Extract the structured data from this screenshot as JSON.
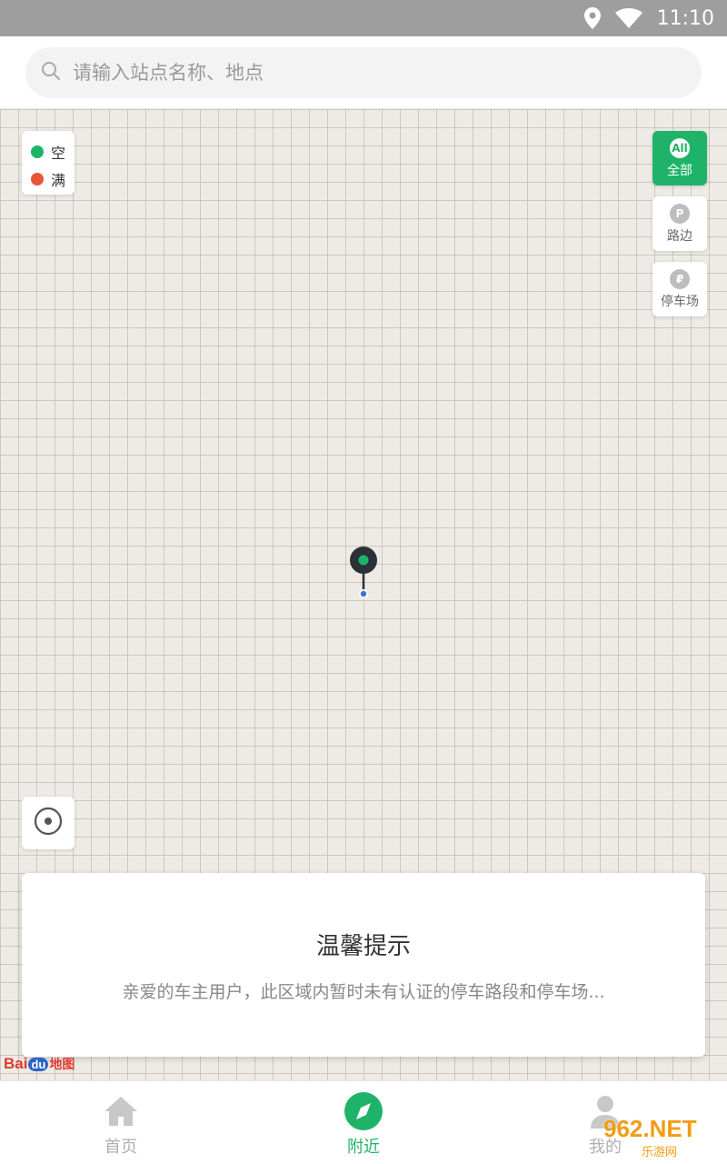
{
  "status_bar": {
    "time": "11:10"
  },
  "search": {
    "placeholder": "请输入站点名称、地点"
  },
  "legend": [
    {
      "label": "空",
      "color": "#1fb36a"
    },
    {
      "label": "满",
      "color": "#e8553b"
    }
  ],
  "filters": [
    {
      "icon_text": "All",
      "label": "全部",
      "active": true
    },
    {
      "icon_text": "P",
      "label": "路边",
      "active": false
    },
    {
      "icon_text": "₽",
      "label": "停车场",
      "active": false
    }
  ],
  "tip": {
    "title": "温馨提示",
    "body": "亲爱的车主用户，此区域内暂时未有认证的停车路段和停车场..."
  },
  "map_logo": {
    "bai": "Bai",
    "du": "du",
    "map": "地图"
  },
  "tabs": [
    {
      "label": "首页",
      "icon": "home-icon",
      "active": false
    },
    {
      "label": "附近",
      "icon": "compass-icon",
      "active": true
    },
    {
      "label": "我的",
      "icon": "user-icon",
      "active": false
    }
  ],
  "watermark": {
    "main": "962.NET",
    "sub": "乐游网"
  },
  "colors": {
    "accent": "#1fb36a",
    "full": "#e8553b",
    "status_bar": "#9e9e9e",
    "map_bg": "#eeebe6"
  }
}
